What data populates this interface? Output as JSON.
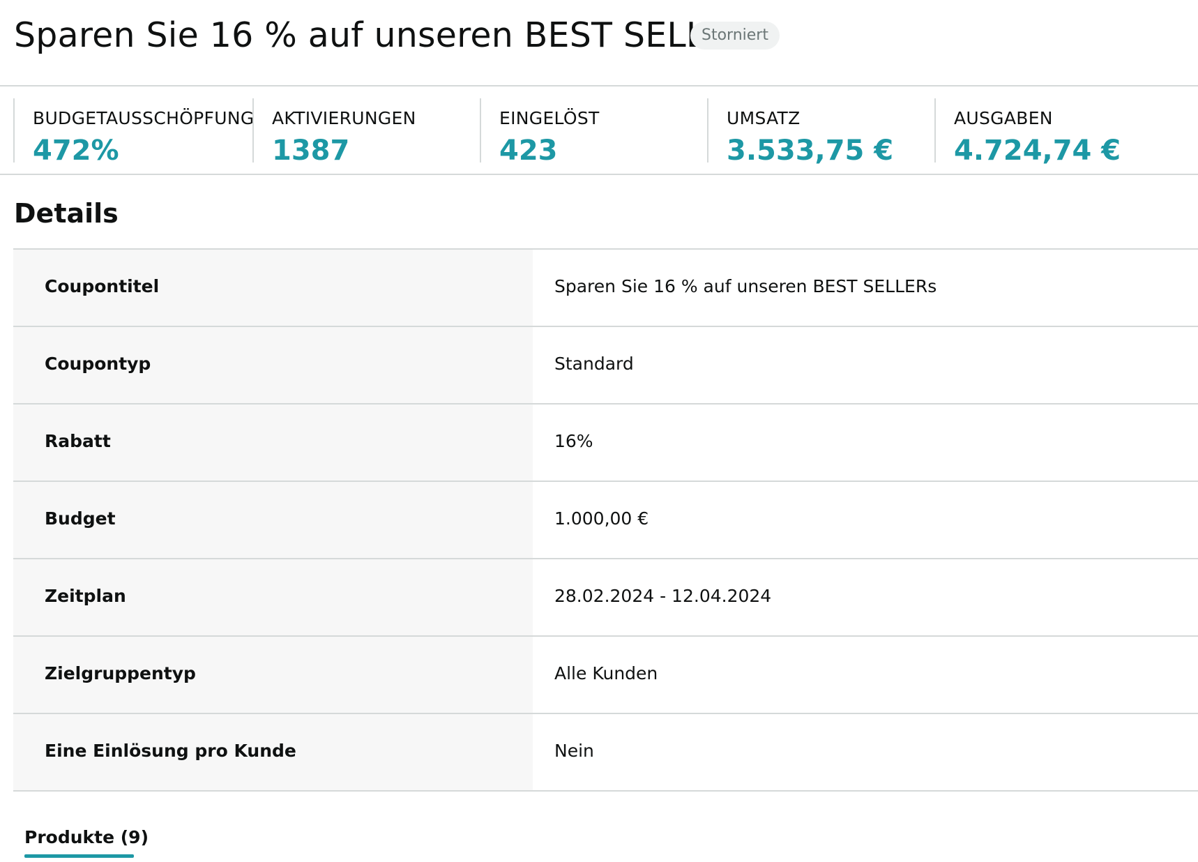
{
  "header": {
    "title": "Sparen Sie 16 % auf unseren BEST SELLERs",
    "status_badge": "Storniert"
  },
  "metrics": [
    {
      "label": "BUDGETAUSSCHÖPFUNG",
      "value": "472%"
    },
    {
      "label": "AKTIVIERUNGEN",
      "value": "1387"
    },
    {
      "label": "EINGELÖST",
      "value": "423"
    },
    {
      "label": "UMSATZ",
      "value": "3.533,75 €"
    },
    {
      "label": "AUSGABEN",
      "value": "4.724,74 €"
    }
  ],
  "details": {
    "title": "Details",
    "rows": [
      {
        "label": "Coupontitel",
        "value": "Sparen Sie 16 % auf unseren BEST SELLERs"
      },
      {
        "label": "Coupontyp",
        "value": "Standard"
      },
      {
        "label": "Rabatt",
        "value": "16%"
      },
      {
        "label": "Budget",
        "value": "1.000,00 €"
      },
      {
        "label": "Zeitplan",
        "value": "28.02.2024 - 12.04.2024"
      },
      {
        "label": "Zielgruppentyp",
        "value": "Alle Kunden"
      },
      {
        "label": "Eine Einlösung pro Kunde",
        "value": "Nein"
      }
    ]
  },
  "tabs": [
    {
      "label": "Produkte (9)",
      "active": true
    }
  ],
  "colors": {
    "accent": "#1d98a5",
    "text": "#0f1111",
    "divider": "#d5d9d9",
    "label_bg": "#f7f7f7",
    "badge_bg": "#f0f2f2"
  }
}
